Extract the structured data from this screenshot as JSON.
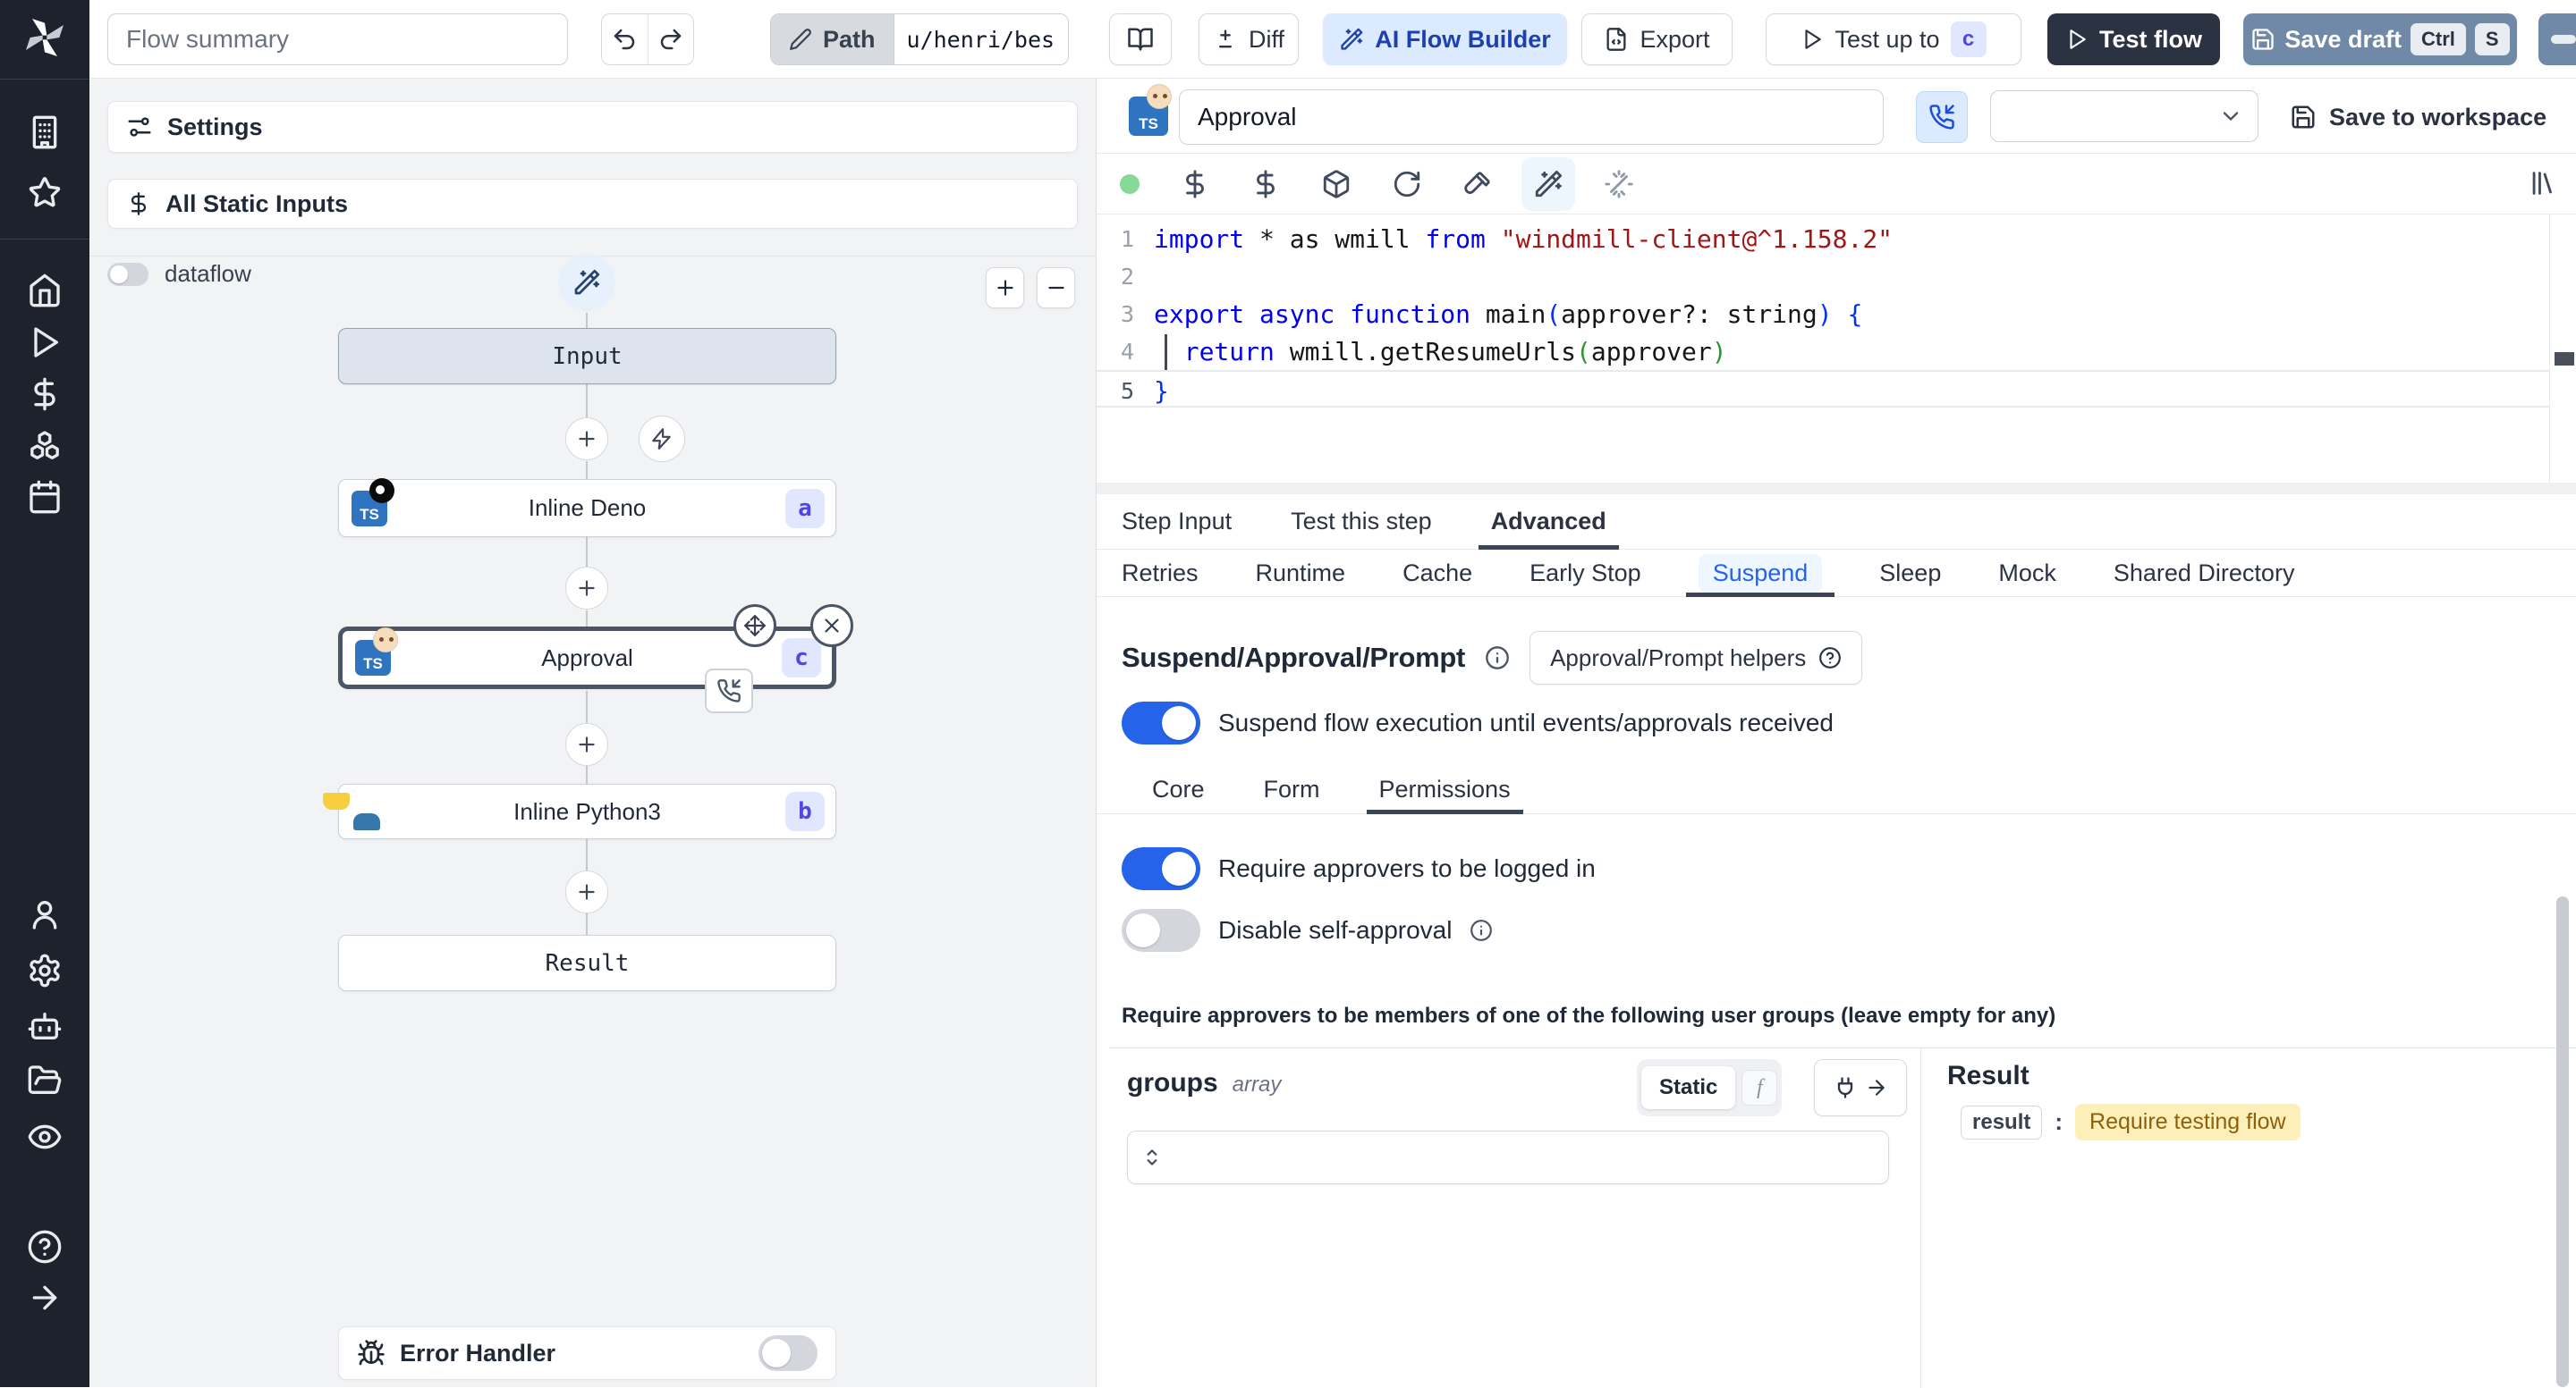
{
  "topbar": {
    "flow_summary": "Flow summary",
    "path_label": "Path",
    "path_value": "u/henri/bes",
    "diff": "Diff",
    "ai_flow_builder": "AI Flow Builder",
    "export": "Export",
    "test_up_to": "Test up to",
    "test_up_to_badge": "c",
    "test_flow": "Test flow",
    "save_draft": "Save draft",
    "kbd_ctrl": "Ctrl",
    "kbd_s": "S"
  },
  "flow": {
    "settings": "Settings",
    "static_inputs_icon": "$",
    "static_inputs": "All Static Inputs",
    "dataflow": "dataflow",
    "input_node": "Input",
    "ts_label": "TS",
    "deno_node": "Inline Deno",
    "deno_badge": "a",
    "approval_node": "Approval",
    "approval_badge": "c",
    "python_node": "Inline Python3",
    "python_badge": "b",
    "result_node": "Result",
    "error_handler": "Error Handler"
  },
  "header": {
    "title": "Approval",
    "ts_label": "TS",
    "save_to_workspace": "Save to workspace"
  },
  "editor": {
    "nums": [
      "1",
      "2",
      "3",
      "4",
      "5"
    ],
    "l1": {
      "k1": "import",
      "p1": " * as wmill ",
      "k2": "from",
      "s1": " \"windmill-client@^1.158.2\""
    },
    "l3": {
      "k1": "export async function",
      "p1": " main",
      "b1": "(",
      "p2": "approver?: string",
      "b2": ")",
      "b3": " {"
    },
    "l4": {
      "p0": "  ",
      "k1": "return",
      "p1": " wmill.getResumeUrls",
      "b1": "(",
      "p2": "approver",
      "b2": ")"
    },
    "l5": {
      "b1": "}"
    }
  },
  "tabs": {
    "t1": "Step Input",
    "t2": "Test this step",
    "t3": "Advanced"
  },
  "advanced_tabs": {
    "t1": "Retries",
    "t2": "Runtime",
    "t3": "Cache",
    "t4": "Early Stop",
    "t5": "Suspend",
    "t6": "Sleep",
    "t7": "Mock",
    "t8": "Shared Directory"
  },
  "suspend": {
    "heading": "Suspend/Approval/Prompt",
    "helpers": "Approval/Prompt helpers",
    "enable": "Suspend flow execution until events/approvals received",
    "tab_core": "Core",
    "tab_form": "Form",
    "tab_permissions": "Permissions",
    "require_login": "Require approvers to be logged in",
    "disable_self": "Disable self-approval",
    "note": "Require approvers to be members of one of the following user groups (leave empty for any)"
  },
  "groups_panel": {
    "name": "groups",
    "type": "array",
    "static_label": "Static",
    "fn_label": "f"
  },
  "result_panel": {
    "title": "Result",
    "key": "result",
    "value": "Require testing flow"
  },
  "colors": {
    "accent": "#2563eb",
    "badge_bg": "#e0e7ff",
    "badge_text": "#4f46e5",
    "result_value_bg": "#fcf0b8",
    "result_value_text": "#8f5f10"
  }
}
